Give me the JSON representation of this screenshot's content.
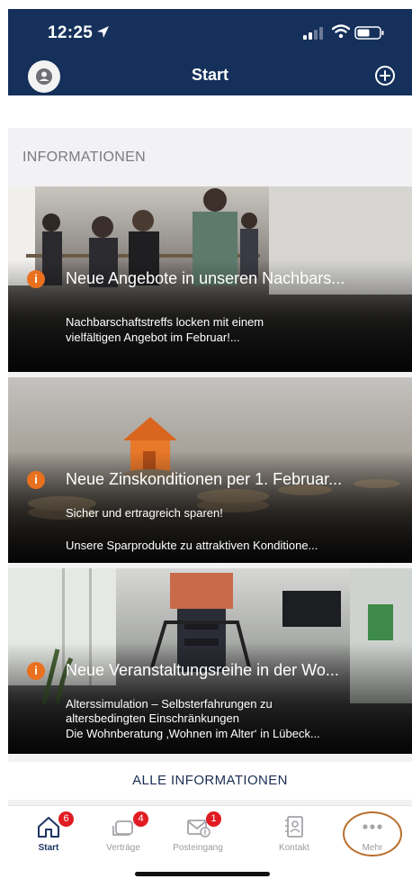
{
  "status_bar": {
    "time": "12:25"
  },
  "header": {
    "title": "Start"
  },
  "section": {
    "title": "INFORMATIONEN"
  },
  "cards": [
    {
      "title": "Neue Angebote in unseren Nachbars...",
      "lines": [
        "Nachbarschaftstreffs locken mit einem",
        "vielfältigen Angebot im Februar!..."
      ]
    },
    {
      "title": "Neue Zinskonditionen per 1. Februar...",
      "lines": [
        "Sicher und ertragreich sparen!",
        "Unsere Sparprodukte zu attraktiven Konditione..."
      ]
    },
    {
      "title": "Neue Veranstaltungsreihe in der Wo...",
      "lines": [
        "Alterssimulation – Selbsterfahrungen zu",
        "altersbedingten Einschränkungen",
        "Die Wohnberatung ‚Wohnen im Alter‘ in Lübeck..."
      ]
    }
  ],
  "all_info_label": "ALLE INFORMATIONEN",
  "tabs": [
    {
      "label": "Start",
      "badge": "6",
      "icon": "home-icon"
    },
    {
      "label": "Verträge",
      "badge": "4",
      "icon": "contracts-icon"
    },
    {
      "label": "Posteingang",
      "badge": "1",
      "icon": "mail-icon"
    },
    {
      "label": "Kontakt",
      "icon": "contact-icon"
    },
    {
      "label": "Mehr",
      "icon": "more-icon"
    }
  ],
  "colors": {
    "header": "#15305a",
    "accent": "#e8701e",
    "badge": "#e11b22",
    "annotation": "#b96f2e"
  }
}
